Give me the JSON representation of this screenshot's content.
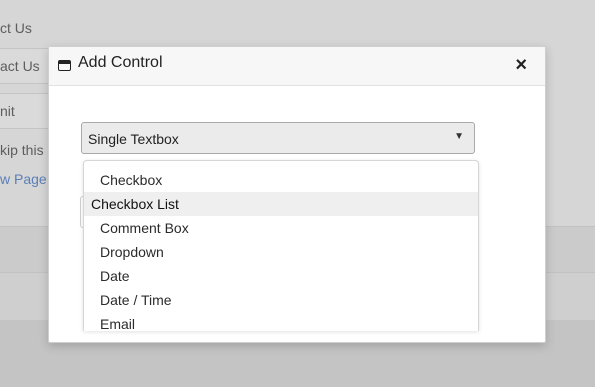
{
  "background": {
    "rows": [
      "ct Us",
      "act Us",
      "nit",
      "kip this p",
      "w Page"
    ]
  },
  "modal": {
    "title": "Add Control",
    "close_label": "×",
    "select": {
      "value": "Single Textbox",
      "caret": "▼"
    },
    "options": [
      {
        "label": "Checkbox",
        "hovered": false
      },
      {
        "label": "Checkbox List",
        "hovered": true
      },
      {
        "label": "Comment Box",
        "hovered": false
      },
      {
        "label": "Dropdown",
        "hovered": false
      },
      {
        "label": "Date",
        "hovered": false
      },
      {
        "label": "Date / Time",
        "hovered": false
      },
      {
        "label": "Email",
        "hovered": false
      }
    ]
  }
}
